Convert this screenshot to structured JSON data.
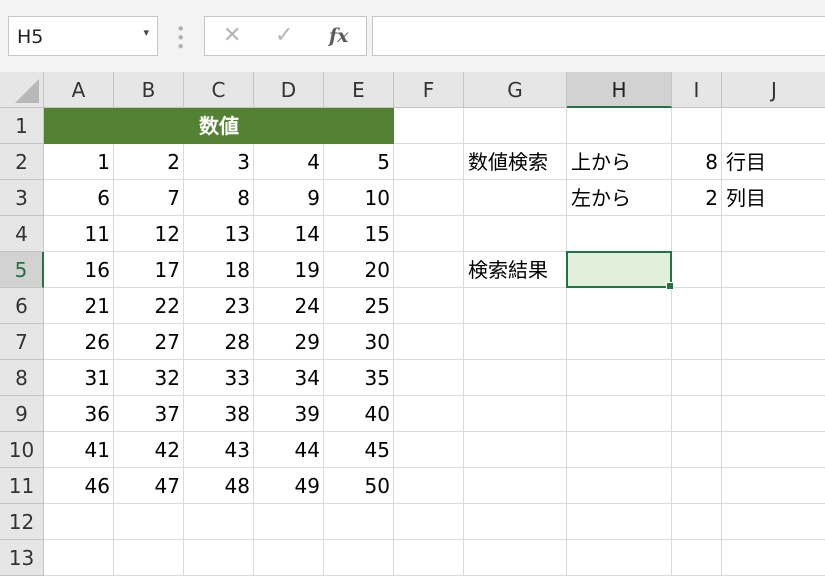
{
  "name_box": {
    "value": "H5",
    "arrow_icon": "chevron-down-icon"
  },
  "formula_bar": {
    "cancel_symbol": "✕",
    "enter_symbol": "✓",
    "fx_label": "fx",
    "content": ""
  },
  "columns": [
    "A",
    "B",
    "C",
    "D",
    "E",
    "F",
    "G",
    "H",
    "I",
    "J"
  ],
  "rows": [
    "1",
    "2",
    "3",
    "4",
    "5",
    "6",
    "7",
    "8",
    "9",
    "10",
    "11",
    "12",
    "13"
  ],
  "selected_cell": {
    "column": "H",
    "row": "5"
  },
  "header_title": "数値",
  "number_table": [
    [
      "1",
      "2",
      "3",
      "4",
      "5"
    ],
    [
      "6",
      "7",
      "8",
      "9",
      "10"
    ],
    [
      "11",
      "12",
      "13",
      "14",
      "15"
    ],
    [
      "16",
      "17",
      "18",
      "19",
      "20"
    ],
    [
      "21",
      "22",
      "23",
      "24",
      "25"
    ],
    [
      "26",
      "27",
      "28",
      "29",
      "30"
    ],
    [
      "31",
      "32",
      "33",
      "34",
      "35"
    ],
    [
      "36",
      "37",
      "38",
      "39",
      "40"
    ],
    [
      "41",
      "42",
      "43",
      "44",
      "45"
    ],
    [
      "46",
      "47",
      "48",
      "49",
      "50"
    ]
  ],
  "lookup": {
    "search_label": "数値検索",
    "row_direction": "上から",
    "row_value": "8",
    "row_unit": "行目",
    "col_direction": "左から",
    "col_value": "2",
    "col_unit": "列目",
    "result_label": "検索結果",
    "result_value": ""
  },
  "colors": {
    "header_fill": "#548235",
    "selection_border": "#217346",
    "selection_fill": "#e2efda"
  }
}
